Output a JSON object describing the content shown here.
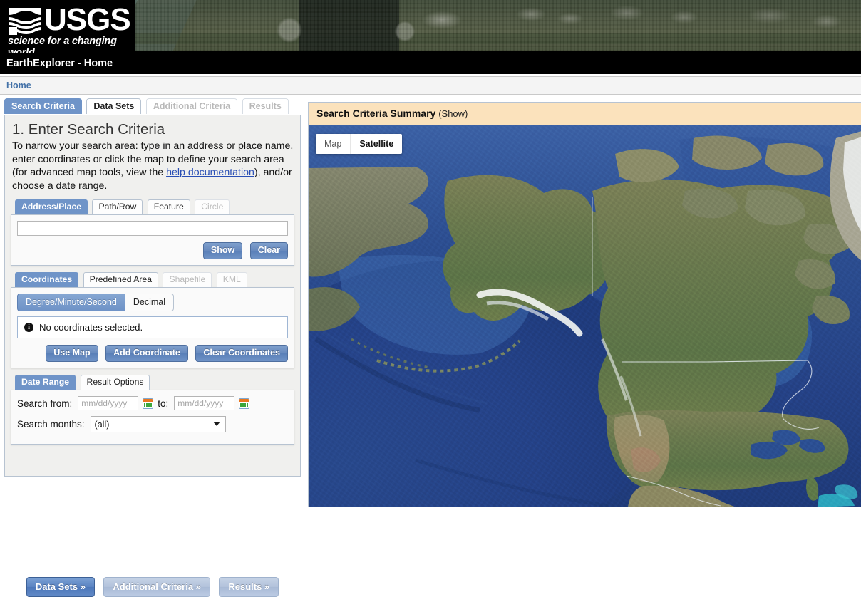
{
  "header": {
    "agency_name": "USGS",
    "tagline": "science for a changing world",
    "banner_alt": "aerial-satellite-imagery-national-mall"
  },
  "title_bar": {
    "title": "EarthExplorer - Home"
  },
  "breadcrumb": {
    "items": [
      {
        "label": "Home"
      }
    ]
  },
  "main_tabs": [
    {
      "label": "Search Criteria",
      "state": "active"
    },
    {
      "label": "Data Sets",
      "state": "enabled"
    },
    {
      "label": "Additional Criteria",
      "state": "disabled"
    },
    {
      "label": "Results",
      "state": "disabled"
    }
  ],
  "criteria": {
    "step_title": "1. Enter Search Criteria",
    "description_part1": "To narrow your search area: type in an address or place name, enter coordinates or click the map to define your search area (for advanced map tools, view the ",
    "help_link": "help documentation",
    "description_part2": "), and/or choose a date range."
  },
  "address_section": {
    "tabs": [
      {
        "label": "Address/Place",
        "state": "active"
      },
      {
        "label": "Path/Row",
        "state": "enabled"
      },
      {
        "label": "Feature",
        "state": "enabled"
      },
      {
        "label": "Circle",
        "state": "disabled"
      }
    ],
    "input_value": "",
    "input_placeholder": "",
    "show_button": "Show",
    "clear_button": "Clear"
  },
  "coordinates_section": {
    "tabs": [
      {
        "label": "Coordinates",
        "state": "active"
      },
      {
        "label": "Predefined Area",
        "state": "enabled"
      },
      {
        "label": "Shapefile",
        "state": "disabled"
      },
      {
        "label": "KML",
        "state": "disabled"
      }
    ],
    "format_toggle": [
      {
        "label": "Degree/Minute/Second",
        "state": "active"
      },
      {
        "label": "Decimal",
        "state": "enabled"
      }
    ],
    "status_message": "No coordinates selected.",
    "status_icon": "info-icon",
    "use_map_button": "Use Map",
    "add_coordinate_button": "Add Coordinate",
    "clear_coordinates_button": "Clear Coordinates"
  },
  "date_section": {
    "tabs": [
      {
        "label": "Date Range",
        "state": "active"
      },
      {
        "label": "Result Options",
        "state": "enabled"
      }
    ],
    "search_from_label": "Search from:",
    "date_from_value": "",
    "date_from_placeholder": "mm/dd/yyyy",
    "to_label": "to:",
    "date_to_value": "",
    "date_to_placeholder": "mm/dd/yyyy",
    "calendar_icon": "calendar-icon",
    "search_months_label": "Search months:",
    "months_selected": "(all)",
    "months_options": [
      "(all)"
    ]
  },
  "footer_buttons": [
    {
      "label": "Data Sets »",
      "state": "enabled"
    },
    {
      "label": "Additional Criteria »",
      "state": "disabled"
    },
    {
      "label": "Results »",
      "state": "disabled"
    }
  ],
  "map": {
    "summary_title": "Search Criteria Summary",
    "summary_toggle": "(Show)",
    "type_controls": [
      {
        "label": "Map",
        "selected": false
      },
      {
        "label": "Satellite",
        "selected": true
      }
    ],
    "view_description": "satellite-view-north-america-alaska-canada-usa"
  },
  "colors": {
    "accent_blue": "#6f94c8",
    "link_blue": "#2a4fb5",
    "breadcrumb_blue": "#4472a8",
    "summary_bg": "#fbe2bc",
    "panel_bg": "#f0f0ee",
    "ocean_blue": "#27458a",
    "header_black": "#000000"
  }
}
